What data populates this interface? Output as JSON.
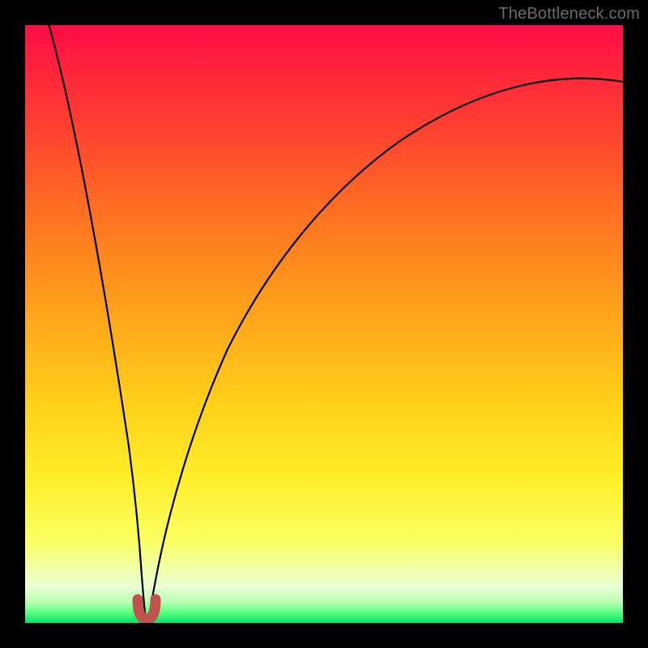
{
  "watermark": "TheBottleneck.com",
  "chart_data": {
    "type": "line",
    "title": "",
    "xlabel": "",
    "ylabel": "",
    "xlim": [
      0,
      100
    ],
    "ylim": [
      0,
      100
    ],
    "grid": false,
    "legend": false,
    "series": [
      {
        "name": "bottleneck-curve",
        "x": [
          4,
          6,
          8,
          10,
          12,
          14,
          16,
          17,
          18,
          18.5,
          19,
          19.3,
          19.6,
          20,
          20.4,
          20.8,
          21.2,
          21.7,
          22.5,
          24,
          26,
          28,
          31,
          35,
          40,
          46,
          53,
          61,
          70,
          80,
          90,
          100
        ],
        "y": [
          100,
          87,
          74,
          62,
          50,
          38,
          26,
          19,
          12,
          8,
          4.5,
          2.5,
          1.2,
          0.6,
          0.6,
          1.2,
          2.5,
          4.6,
          8.5,
          15,
          23,
          30,
          38,
          47,
          55,
          63,
          70,
          76,
          81,
          85,
          88,
          90
        ]
      }
    ],
    "annotations": [
      {
        "name": "optimal-region",
        "shape": "u-arc",
        "center_x": 20,
        "y_bottom": 0.8,
        "y_top": 3.2,
        "width": 2.4,
        "color": "#c1534e"
      }
    ],
    "background": {
      "type": "vertical-gradient",
      "stops": [
        {
          "pos": 0.0,
          "color": "#ff0b47"
        },
        {
          "pos": 0.18,
          "color": "#ff4330"
        },
        {
          "pos": 0.48,
          "color": "#ffa31a"
        },
        {
          "pos": 0.76,
          "color": "#ffee2a"
        },
        {
          "pos": 0.94,
          "color": "#e8ffd4"
        },
        {
          "pos": 1.0,
          "color": "#00e66a"
        }
      ]
    }
  }
}
